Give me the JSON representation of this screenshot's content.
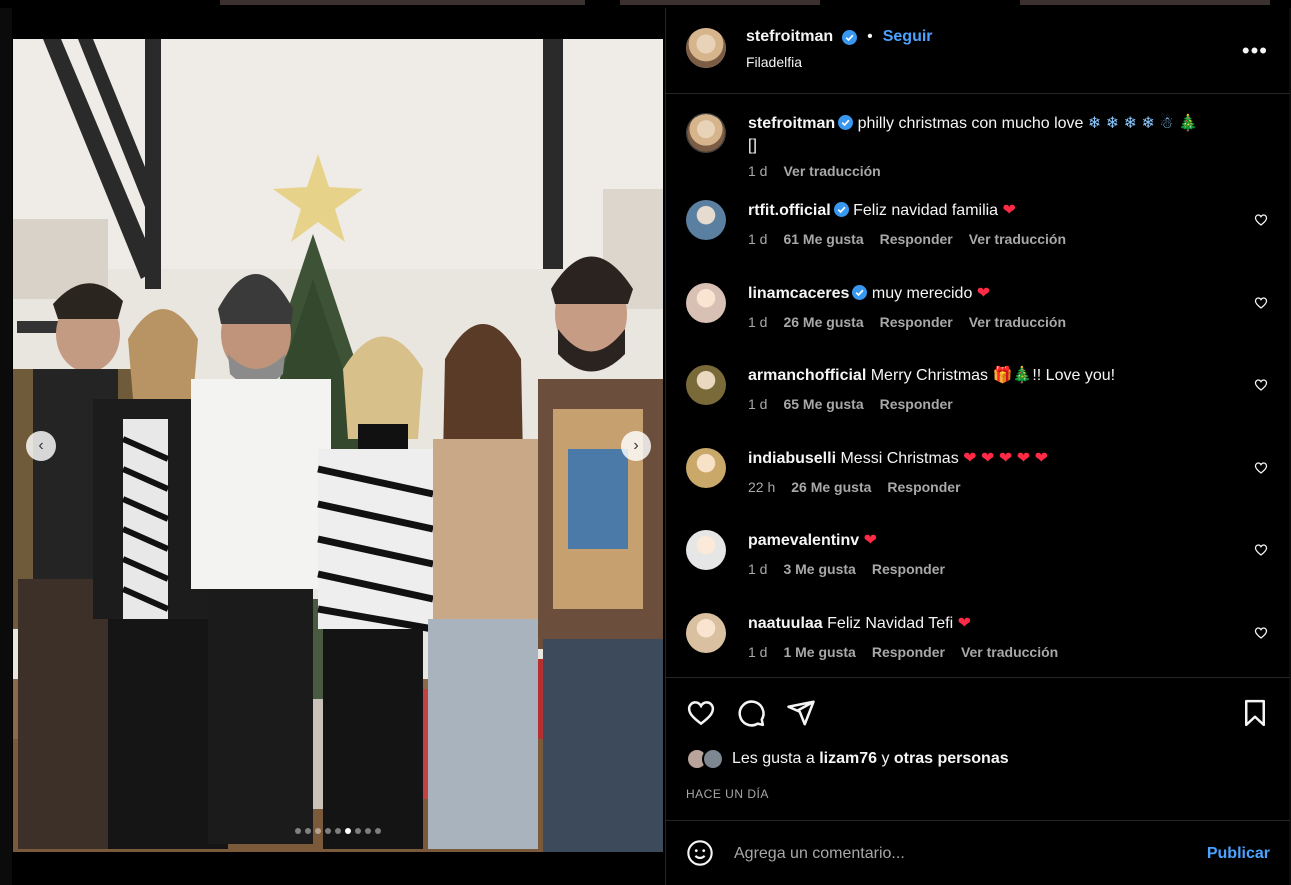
{
  "post": {
    "username": "stefroitman",
    "follow_label": "Seguir",
    "location": "Filadelfia",
    "more_label": "•••",
    "caption_text": "philly christmas con mucho love",
    "caption_emojis": "❄ ❄ ❄ ❄ ☃ 🎄",
    "caption_extra": "[]",
    "caption_time": "1 d",
    "caption_translate": "Ver traducción"
  },
  "carousel": {
    "prev": "‹",
    "next": "›",
    "slide_count": 9,
    "active_index": 5
  },
  "comments": [
    {
      "user": "rtfit.official",
      "verified": true,
      "text": "Feliz navidad familia",
      "emoji": "❤",
      "time": "1 d",
      "likes": "61 Me gusta",
      "reply": "Responder",
      "translate": "Ver traducción"
    },
    {
      "user": "linamcaceres",
      "verified": true,
      "text": "muy merecido",
      "emoji": "❤",
      "time": "1 d",
      "likes": "26 Me gusta",
      "reply": "Responder",
      "translate": "Ver traducción"
    },
    {
      "user": "armanchofficial",
      "verified": false,
      "text": "Merry Christmas 🎁🎄!! Love you!",
      "emoji": "",
      "time": "1 d",
      "likes": "65 Me gusta",
      "reply": "Responder",
      "translate": ""
    },
    {
      "user": "indiabuselli",
      "verified": false,
      "text": "Messi Christmas",
      "emoji": "❤ ❤ ❤ ❤ ❤",
      "time": "22 h",
      "likes": "26 Me gusta",
      "reply": "Responder",
      "translate": ""
    },
    {
      "user": "pamevalentinv",
      "verified": false,
      "text": "",
      "emoji": "❤",
      "time": "1 d",
      "likes": "3 Me gusta",
      "reply": "Responder",
      "translate": ""
    },
    {
      "user": "naatuulaa",
      "verified": false,
      "text": "Feliz Navidad Tefi",
      "emoji": "❤",
      "time": "1 d",
      "likes": "1 Me gusta",
      "reply": "Responder",
      "translate": "Ver traducción"
    }
  ],
  "footer": {
    "likes_prefix": "Les gusta a",
    "likes_user": "lizam76",
    "likes_mid": "y",
    "likes_suffix": "otras personas",
    "posted": "HACE UN DÍA",
    "comment_placeholder": "Agrega un comentario...",
    "publish_label": "Publicar"
  },
  "colors": {
    "accent": "#4aa3ff",
    "heart": "#ff2a45",
    "background": "#000000",
    "muted": "#a8a8a8"
  },
  "icons": [
    "verified-badge-icon",
    "more-options-icon",
    "like-icon",
    "comment-icon",
    "share-icon",
    "save-icon",
    "emoji-icon",
    "carousel-prev-icon",
    "carousel-next-icon"
  ]
}
